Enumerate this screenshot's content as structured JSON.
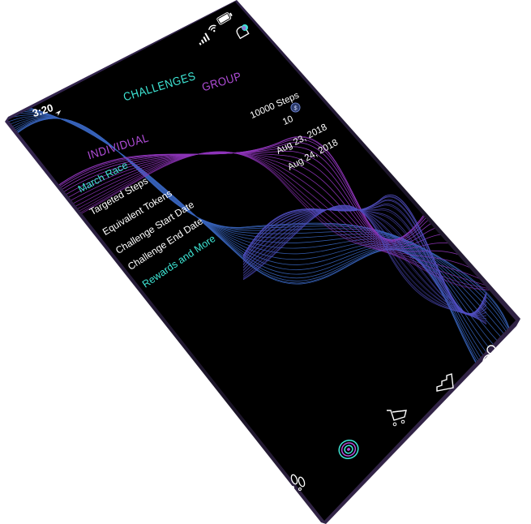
{
  "status_bar": {
    "time": "3:20"
  },
  "tabs": {
    "challenges": "CHALLENGES",
    "group": "GROUP",
    "individual": "INDIVIDUAL"
  },
  "challenge": {
    "title": "March Race",
    "fields": [
      {
        "label": "Targeted Steps",
        "value": "10000 Steps"
      },
      {
        "label": "Equivalent Tokens",
        "value": "10"
      },
      {
        "label": "Challenge Start Date",
        "value": "Aug 23, 2018"
      },
      {
        "label": "Challenge End Date",
        "value": "Aug 24, 2018"
      }
    ],
    "rewards_link": "Rewards and More"
  },
  "bottom_nav": [
    {
      "icon": "footsteps-icon",
      "active": false
    },
    {
      "icon": "target-rings-icon",
      "active": true
    },
    {
      "icon": "cart-icon",
      "active": false
    },
    {
      "icon": "stairs-icon",
      "active": false
    },
    {
      "icon": "user-icon",
      "active": false
    }
  ],
  "colors": {
    "accent_teal": "#3ee6d5",
    "accent_purple": "#b04dd8",
    "background": "#000000"
  }
}
